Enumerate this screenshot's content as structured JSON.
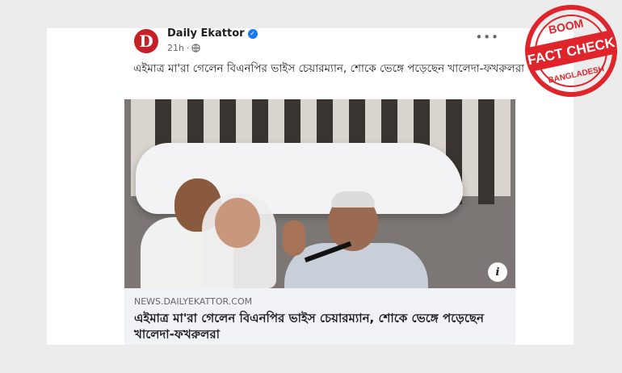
{
  "post": {
    "page_name": "Daily Ekattor",
    "avatar_letter": "D",
    "timestamp": "21h",
    "privacy_icon": "globe-icon",
    "more_icon": "more-options-icon",
    "text": "এইমাত্র মা'রা গেলেন বিএনপির ভাইস চেয়ারম্যান, শোকে ভেঙ্গে পড়েছেন খালেদা-ফখরুলরা"
  },
  "link_preview": {
    "domain": "NEWS.DAILYEKATTOR.COM",
    "headline": "এইমাত্র মা'রা গেলেন বিএনপির ভাইস চেয়ারম্যান, শোকে ভেঙ্গে পড়েছেন খালেদা-ফখরুলরা",
    "info_icon": "info-icon"
  },
  "stamp": {
    "top_text": "BOOM",
    "main_text": "FACT CHECK",
    "bottom_text": "BANGLADESH",
    "color": "#e0242b"
  },
  "colors": {
    "brand_red": "#c62026",
    "facebook_blue": "#1877f2"
  }
}
